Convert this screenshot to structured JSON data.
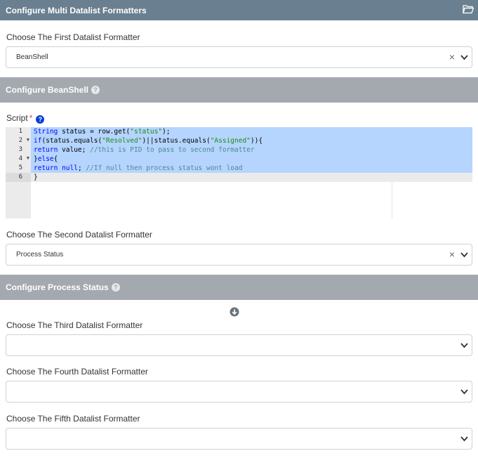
{
  "header": {
    "title": "Configure Multi Datalist Formatters",
    "icon": "folder-open-icon"
  },
  "first": {
    "label": "Choose The First Datalist Formatter",
    "value": "BeanShell"
  },
  "beanshell": {
    "title": "Configure BeanShell",
    "help": "?"
  },
  "script": {
    "label": "Script",
    "required_mark": "*",
    "help": "?",
    "line_numbers": [
      "1",
      "2",
      "3",
      "4",
      "5",
      "6"
    ],
    "lines": [
      "String status = row.get(\"status\");",
      "if(status.equals(\"Resolved\")||status.equals(\"Assigned\")){",
      "return value; //this is PID to pass to second formatter",
      "}else{",
      "return null; //If null then process status wont load",
      "}"
    ]
  },
  "second": {
    "label": "Choose The Second Datalist Formatter",
    "value": "Process Status"
  },
  "process_status": {
    "title": "Configure Process Status",
    "help": "?"
  },
  "third": {
    "label": "Choose The Third Datalist Formatter",
    "value": ""
  },
  "fourth": {
    "label": "Choose The Fourth Datalist Formatter",
    "value": ""
  },
  "fifth": {
    "label": "Choose The Fifth Datalist Formatter",
    "value": ""
  },
  "colors": {
    "header_bg": "#6a7f8f",
    "subheader_bg": "#a3a9ae",
    "help_blue": "#0d3fd1",
    "selection": "#b5d5ff"
  }
}
